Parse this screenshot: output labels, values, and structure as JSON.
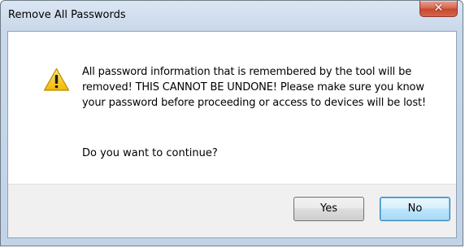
{
  "window": {
    "title": "Remove All Passwords"
  },
  "icons": {
    "close": "close-icon",
    "warning": "warning-icon"
  },
  "dialog": {
    "message": "All password information that is remembered by the tool will be removed!  THIS CANNOT BE UNDONE!  Please make sure you know your password before proceeding or access to devices will be lost!",
    "question": "Do you want to continue?"
  },
  "buttons": {
    "yes_label": "Yes",
    "no_label": "No"
  },
  "colors": {
    "close_button": "#c7472e",
    "warning_fill": "#f5c518",
    "default_button_border": "#3c7fb1"
  }
}
